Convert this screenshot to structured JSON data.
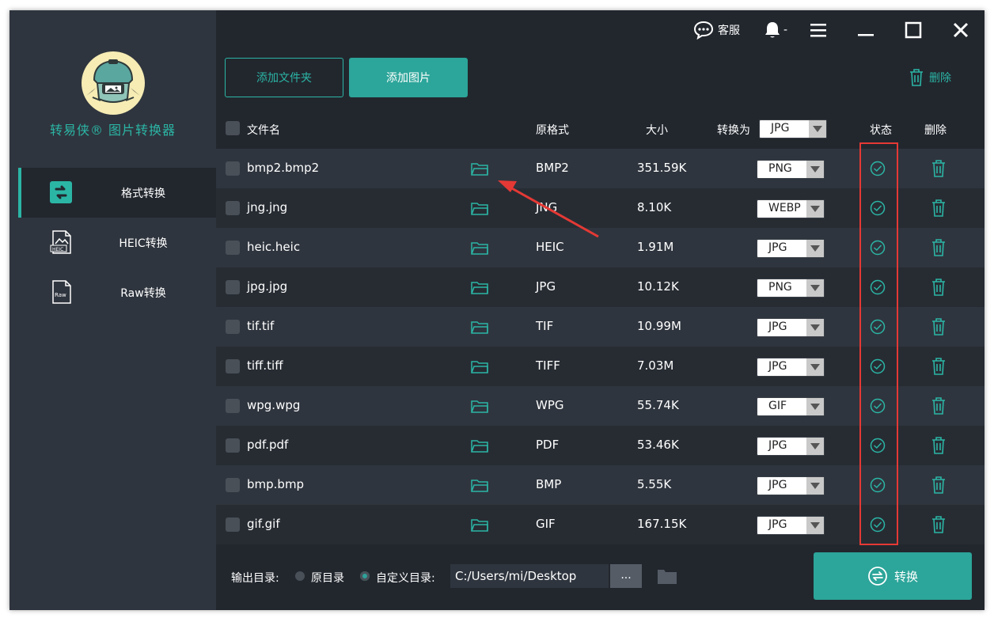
{
  "app": {
    "title": "转易侠® 图片转换器"
  },
  "titlebar": {
    "support_label": "客服",
    "user_label": "-"
  },
  "sidebar": {
    "items": [
      {
        "label": "格式转换",
        "icon": "format-convert-icon",
        "active": true
      },
      {
        "label": "HEIC转换",
        "icon": "heic-file-icon",
        "active": false
      },
      {
        "label": "Raw转换",
        "icon": "raw-file-icon",
        "active": false
      }
    ]
  },
  "toolbar": {
    "add_folder_label": "添加文件夹",
    "add_image_label": "添加图片",
    "delete_label": "删除"
  },
  "table": {
    "headers": {
      "filename": "文件名",
      "original_format": "原格式",
      "size": "大小",
      "convert_to": "转换为",
      "convert_to_value": "JPG",
      "status": "状态",
      "delete": "删除"
    },
    "rows": [
      {
        "name": "bmp2.bmp2",
        "format": "BMP2",
        "size": "351.59K",
        "target": "PNG"
      },
      {
        "name": "jng.jng",
        "format": "JNG",
        "size": "8.10K",
        "target": "WEBP"
      },
      {
        "name": "heic.heic",
        "format": "HEIC",
        "size": "1.91M",
        "target": "JPG"
      },
      {
        "name": "jpg.jpg",
        "format": "JPG",
        "size": "10.12K",
        "target": "PNG"
      },
      {
        "name": "tif.tif",
        "format": "TIF",
        "size": "10.99M",
        "target": "JPG"
      },
      {
        "name": "tiff.tiff",
        "format": "TIFF",
        "size": "7.03M",
        "target": "JPG"
      },
      {
        "name": "wpg.wpg",
        "format": "WPG",
        "size": "55.74K",
        "target": "GIF"
      },
      {
        "name": "pdf.pdf",
        "format": "PDF",
        "size": "53.46K",
        "target": "JPG"
      },
      {
        "name": "bmp.bmp",
        "format": "BMP",
        "size": "5.55K",
        "target": "JPG"
      },
      {
        "name": "gif.gif",
        "format": "GIF",
        "size": "167.15K",
        "target": "JPG"
      }
    ]
  },
  "footer": {
    "output_label": "输出目录:",
    "option_original": "原目录",
    "option_custom": "自定义目录:",
    "path": "C:/Users/mi/Desktop",
    "browse_label": "...",
    "convert_label": "转换"
  },
  "colors": {
    "accent": "#2bb5a5",
    "highlight": "#e53935",
    "background": "#22272e"
  }
}
